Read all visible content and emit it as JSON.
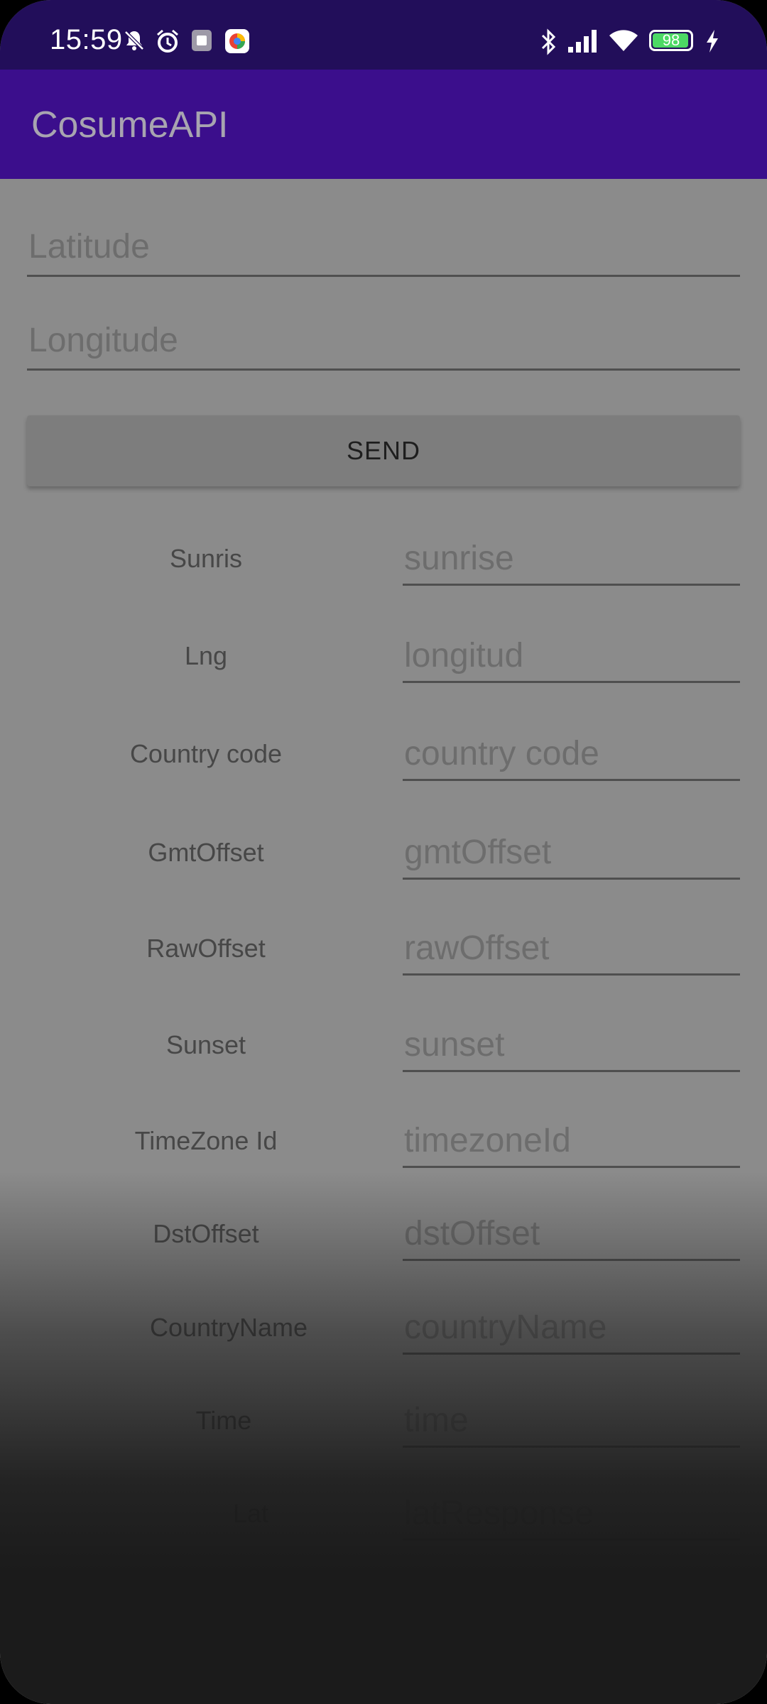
{
  "status_bar": {
    "time": "15:59",
    "battery": "98",
    "icons": [
      "mute-icon",
      "alarm-icon",
      "android-icon",
      "app-icon",
      "bluetooth-icon",
      "signal-icon",
      "wifi-icon",
      "battery-icon",
      "charging-icon"
    ]
  },
  "app_bar": {
    "title": "CosumeAPI"
  },
  "form": {
    "latitude_placeholder": "Latitude",
    "longitude_placeholder": "Longitude",
    "send_label": "SEND"
  },
  "rows": [
    {
      "label": "Sunris",
      "placeholder": "sunrise"
    },
    {
      "label": "Lng",
      "placeholder": "longitud"
    },
    {
      "label": "Country code",
      "placeholder": "country code"
    },
    {
      "label": "GmtOffset",
      "placeholder": "gmtOffset"
    },
    {
      "label": "RawOffset",
      "placeholder": "rawOffset"
    },
    {
      "label": "Sunset",
      "placeholder": "sunset"
    },
    {
      "label": "TimeZone Id",
      "placeholder": "timezoneId"
    },
    {
      "label": "DstOffset",
      "placeholder": "dstOffset"
    },
    {
      "label": "CountryName",
      "placeholder": "countryName"
    },
    {
      "label": "Time",
      "placeholder": "time"
    },
    {
      "label": "Lat",
      "placeholder": "latResponse"
    }
  ],
  "colors": {
    "status_bar": "#220e5a",
    "app_bar": "#3b0e8c",
    "scrim": "#8b8b8b"
  }
}
